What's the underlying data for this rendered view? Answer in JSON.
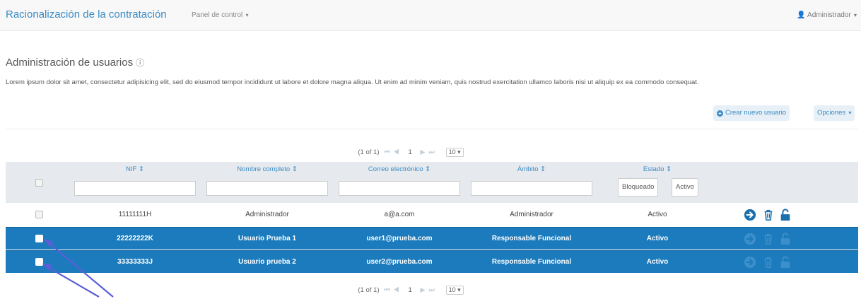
{
  "navbar": {
    "brand": "Racionalización de la contratación",
    "menu_label": "Panel de control",
    "user_label": "Administrador"
  },
  "page": {
    "title": "Administración de usuarios",
    "description": "Lorem ipsum dolor sit amet, consectetur adipisicing elit, sed do eiusmod tempor incididunt ut labore et dolore magna aliqua. Ut enim ad minim veniam, quis nostrud exercitation ullamco laboris nisi ut aliquip ex ea commodo consequat."
  },
  "toolbar": {
    "create_label": "Crear nuevo usuario",
    "options_label": "Opciones"
  },
  "paginator": {
    "summary": "(1 of 1)",
    "first": "⏮",
    "prev": "◀",
    "page": "1",
    "next": "▶",
    "last": "⏭",
    "rows_per_page": "10"
  },
  "table": {
    "columns": {
      "nif": "NIF",
      "name": "Nombre completo",
      "email": "Correo electrónico",
      "scope": "Ámbito",
      "status": "Estado"
    },
    "sort_glyph": "⇕",
    "status_filter": {
      "blocked": "Bloqueado",
      "active": "Activo"
    },
    "rows": [
      {
        "nif": "11111111H",
        "name": "Administrador",
        "email": "a@a.com",
        "scope": "Administrador",
        "status": "Activo",
        "selected": false
      },
      {
        "nif": "22222222K",
        "name": "Usuario Prueba 1",
        "email": "user1@prueba.com",
        "scope": "Responsable Funcional",
        "status": "Activo",
        "selected": true
      },
      {
        "nif": "33333333J",
        "name": "Usuario prueba 2",
        "email": "user2@prueba.com",
        "scope": "Responsable Funcional",
        "status": "Activo",
        "selected": true
      }
    ]
  },
  "colors": {
    "brand": "#3a8bc4",
    "selected_row": "#1b7bbd",
    "annotation_arrow": "#5b5fd6"
  },
  "icons": [
    "info-icon",
    "user-icon",
    "plus-circle-icon",
    "arrow-right-circle-icon",
    "trash-icon",
    "unlock-icon"
  ]
}
